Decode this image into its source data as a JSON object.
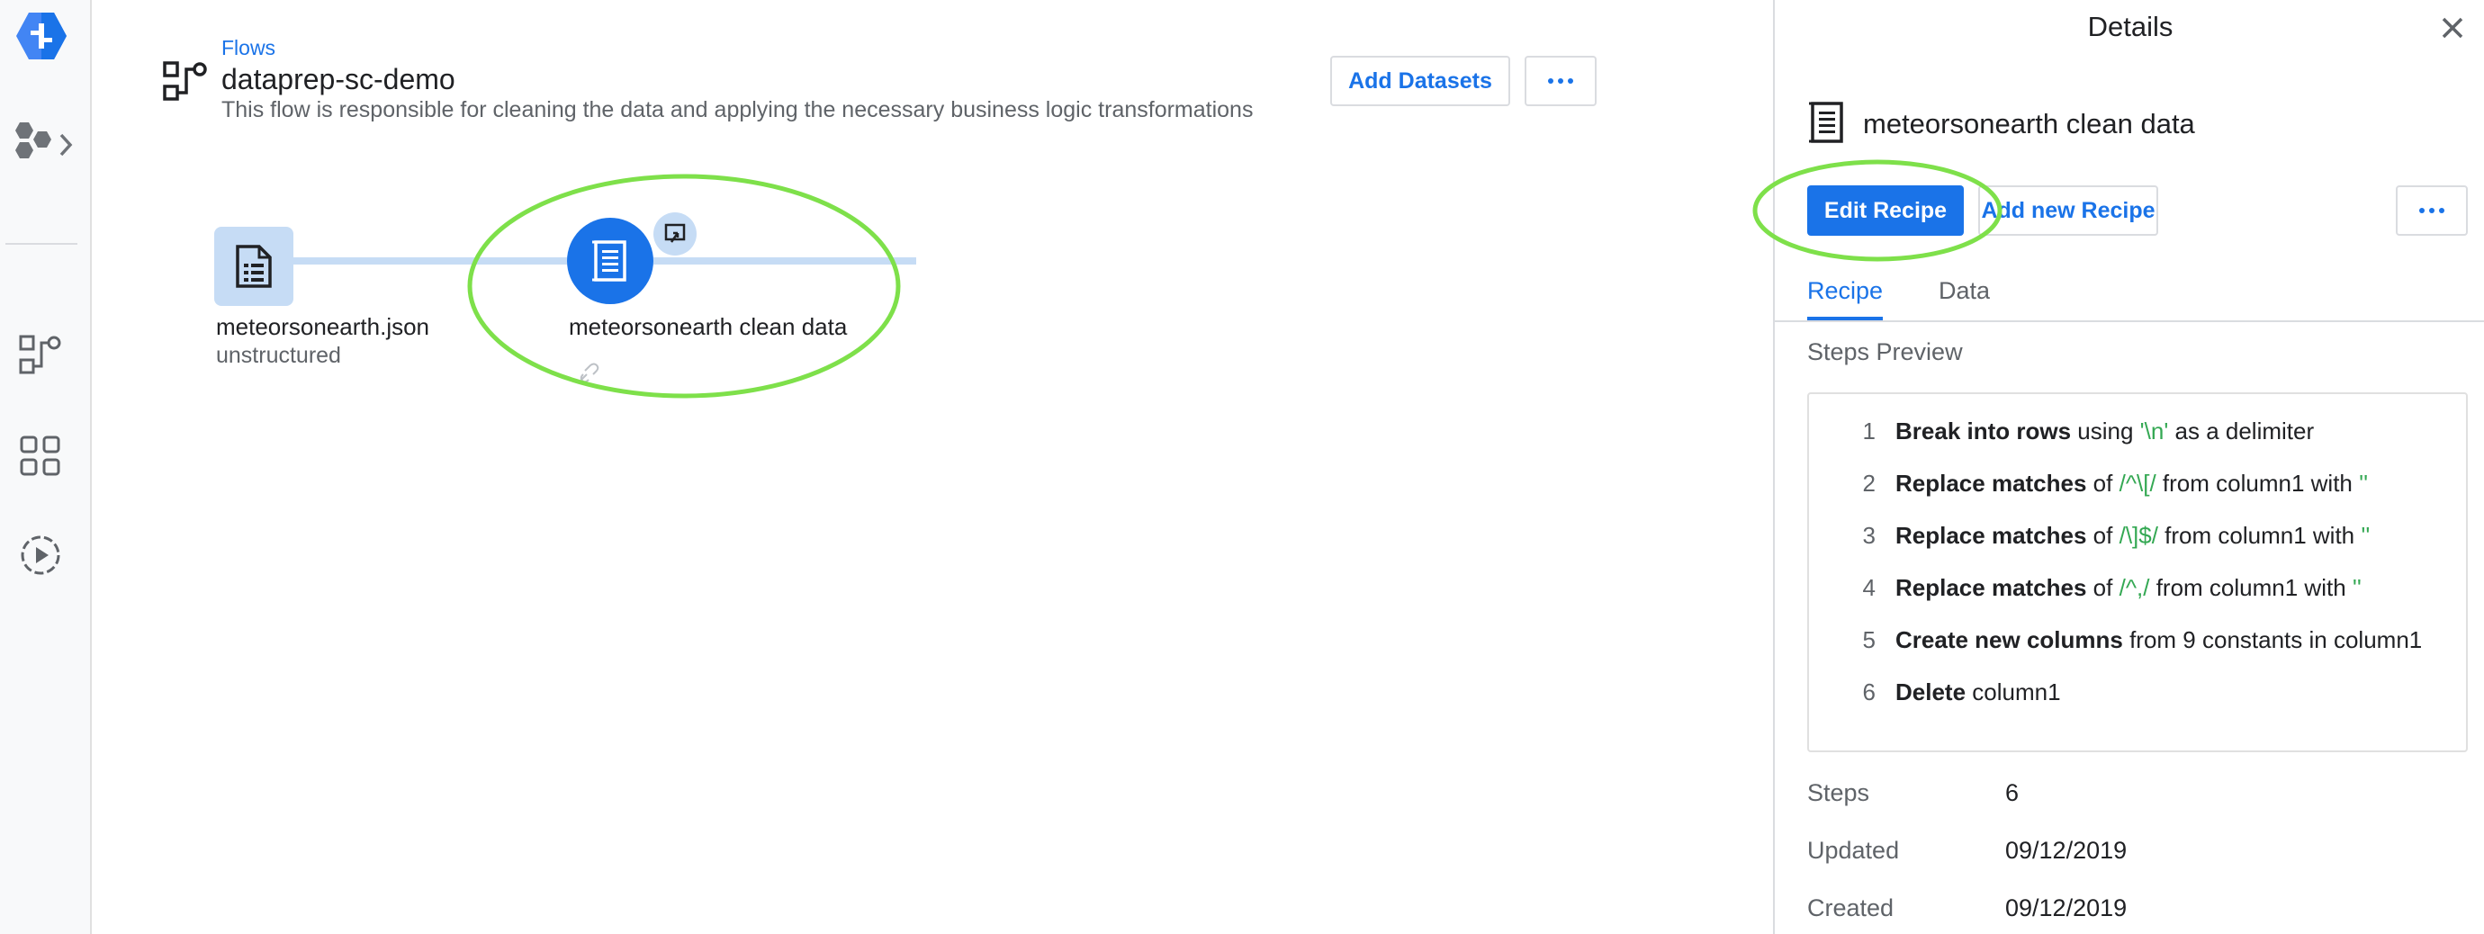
{
  "header": {
    "breadcrumb": "Flows",
    "title": "dataprep-sc-demo",
    "description": "This flow is responsible for cleaning the data and applying the necessary business logic transformations",
    "add_datasets_label": "Add Datasets"
  },
  "canvas": {
    "dataset": {
      "name": "meteorsonearth.json",
      "subtitle": "unstructured"
    },
    "recipe": {
      "name": "meteorsonearth clean data"
    }
  },
  "details": {
    "title": "Details",
    "recipe_name": "meteorsonearth clean data",
    "edit_recipe_label": "Edit Recipe",
    "add_new_recipe_label": "Add new Recipe",
    "tabs": [
      {
        "label": "Recipe",
        "active": true
      },
      {
        "label": "Data",
        "active": false
      }
    ],
    "steps_preview_label": "Steps Preview",
    "steps": [
      {
        "num": "1",
        "action": "Break into rows",
        "p1": " using ",
        "v1": "'\\n'",
        "p2": " as a delimiter"
      },
      {
        "num": "2",
        "action": "Replace matches",
        "p1": " of ",
        "v1": "/^\\[/",
        "p2": " from column1 with ",
        "v2": "''"
      },
      {
        "num": "3",
        "action": "Replace matches",
        "p1": " of ",
        "v1": "/\\]$/",
        "p2": " from column1 with ",
        "v2": "''"
      },
      {
        "num": "4",
        "action": "Replace matches",
        "p1": " of ",
        "v1": "/^,/",
        "p2": " from column1 with ",
        "v2": "''"
      },
      {
        "num": "5",
        "action": "Create new columns",
        "p1": " from 9 constants in column1"
      },
      {
        "num": "6",
        "action": "Delete",
        "p1": " column1"
      }
    ],
    "meta": [
      {
        "label": "Steps",
        "value": "6"
      },
      {
        "label": "Updated",
        "value": "09/12/2019"
      },
      {
        "label": "Created",
        "value": "09/12/2019"
      }
    ]
  },
  "colors": {
    "accent": "#1a73e8",
    "node_light": "#c6dcf5",
    "annotation": "#7ee04a",
    "value_green": "#34a853"
  },
  "icons": [
    "dataprep-logo-icon",
    "products-icon",
    "chevron-right-icon",
    "flows-icon",
    "library-icon",
    "jobs-icon",
    "flow-icon",
    "dataset-file-icon",
    "recipe-icon",
    "output-icon",
    "link-icon",
    "close-icon",
    "more-horiz-icon"
  ]
}
